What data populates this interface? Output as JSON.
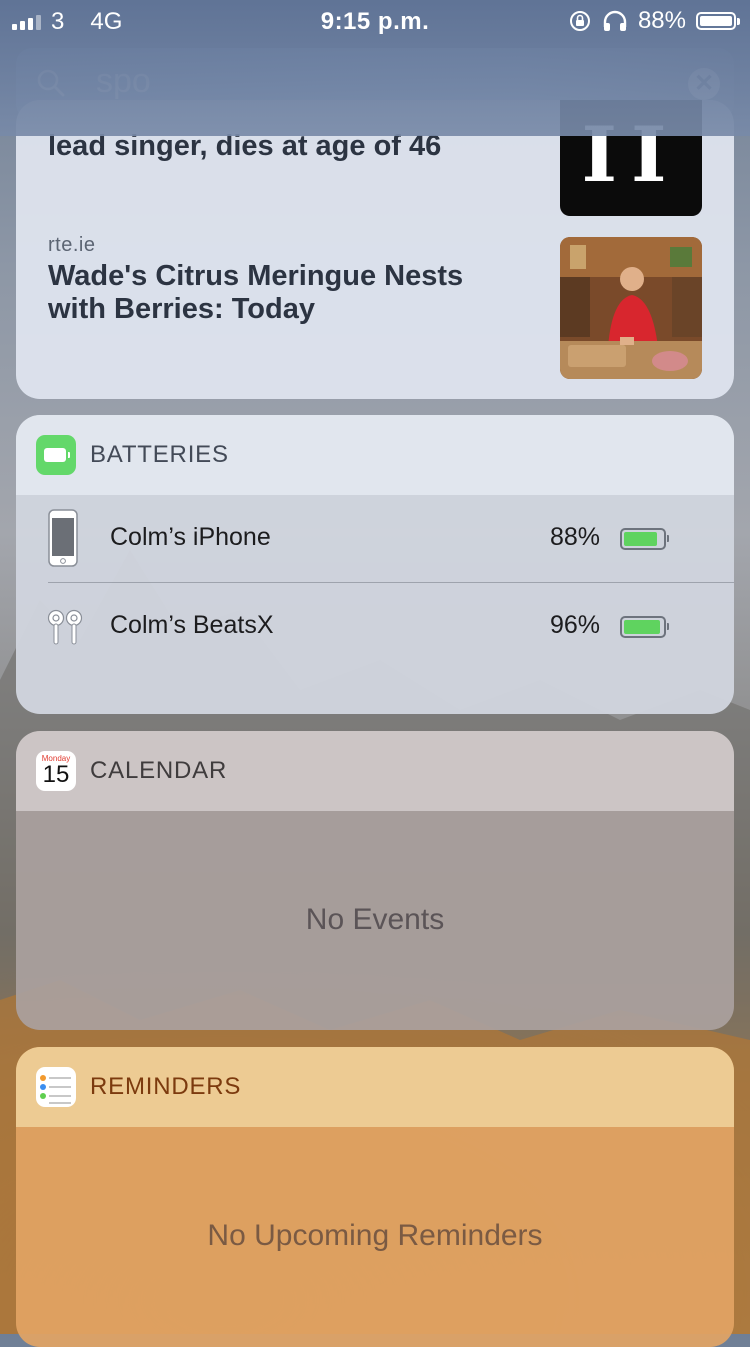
{
  "status_bar": {
    "carrier": "3",
    "network": "4G",
    "time": "9:15 p.m.",
    "battery_percent": "88%",
    "battery_level": 0.88
  },
  "search": {
    "query": "spo"
  },
  "news": {
    "item1_headline": "lead singer, dies at age of 46",
    "item2_source": "rte.ie",
    "item2_headline": "Wade's Citrus Meringue Nests with Berries: Today"
  },
  "batteries": {
    "title": "BATTERIES",
    "devices": [
      {
        "name": "Colm’s iPhone",
        "percent": "88%",
        "level": 0.88
      },
      {
        "name": "Colm’s BeatsX",
        "percent": "96%",
        "level": 0.96
      }
    ]
  },
  "calendar": {
    "title": "CALENDAR",
    "icon_day": "Monday",
    "icon_date": "15",
    "empty_text": "No Events"
  },
  "reminders": {
    "title": "REMINDERS",
    "empty_text": "No Upcoming Reminders"
  },
  "colors": {
    "battery_green": "#5fd35f",
    "batteries_icon": "#63d86a",
    "reminders_title": "#7c3a0e"
  }
}
